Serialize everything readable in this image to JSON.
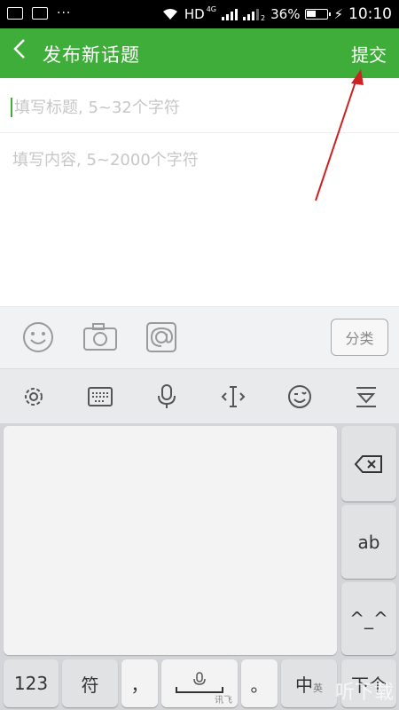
{
  "status_bar": {
    "network": "HD",
    "net_tag_1": "4G",
    "net_tag_2": "2",
    "battery": "36%",
    "time": "10:10",
    "dots": "···"
  },
  "app_bar": {
    "back_glyph": "<",
    "title": "发布新话题",
    "submit_label": "提交"
  },
  "form": {
    "title_placeholder": "填写标题, 5~32个字符",
    "content_placeholder": "填写内容, 5~2000个字符"
  },
  "toolbar": {
    "category_label": "分类",
    "icons": [
      "emoji-icon",
      "camera-icon",
      "at-icon"
    ]
  },
  "keyboard": {
    "toolbar_icons": [
      "settings-icon",
      "keyboard-icon",
      "mic-icon",
      "cursor-icon",
      "emoticon-icon",
      "collapse-icon"
    ],
    "keys": {
      "ab": "ab",
      "face": "^_^",
      "num": "123",
      "sym": "符",
      "comma": "，",
      "space_brand": "讯飞",
      "period": "。",
      "lang_main": "中",
      "lang_sub": "英",
      "enter": "下个"
    },
    "watermark": "听下载"
  },
  "colors": {
    "accent": "#3fad39",
    "annotation": "#cc2222"
  }
}
